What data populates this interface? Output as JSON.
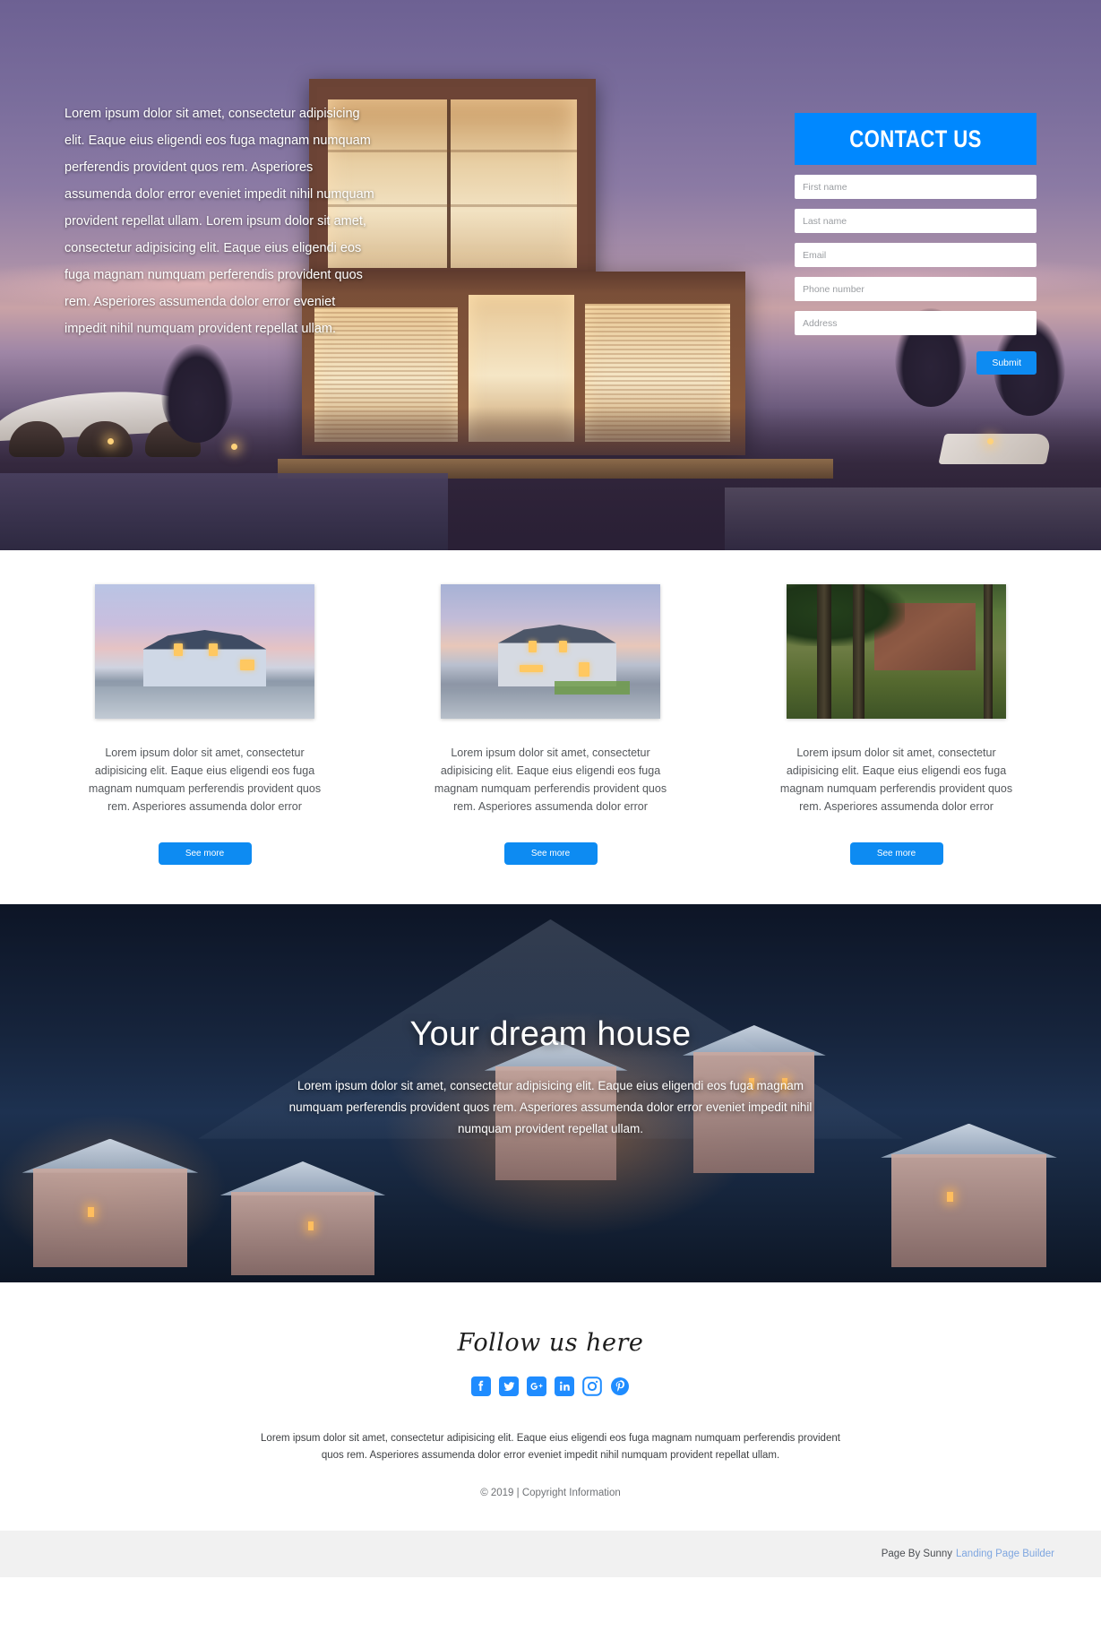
{
  "theme": {
    "accent_blue": "#0088ff",
    "button_blue": "#0d8bf2",
    "bottom_bar_bg": "#f1f1f1",
    "link_blue": "#7ea6e0"
  },
  "hero": {
    "paragraph": "Lorem ipsum dolor sit amet, consectetur adipisicing elit. Eaque eius eligendi eos fuga magnam numquam perferendis provident quos rem. Asperiores assumenda dolor error eveniet impedit nihil numquam provident repellat ullam. Lorem ipsum dolor sit amet, consectetur adipisicing elit. Eaque eius eligendi eos fuga magnam numquam perferendis provident quos rem. Asperiores assumenda dolor error eveniet impedit nihil numquam provident repellat ullam.",
    "form": {
      "title": "CONTACT US",
      "fields": [
        {
          "name": "first-name",
          "placeholder": "First name",
          "value": ""
        },
        {
          "name": "last-name",
          "placeholder": "Last name",
          "value": ""
        },
        {
          "name": "email",
          "placeholder": "Email",
          "value": ""
        },
        {
          "name": "phone",
          "placeholder": "Phone number",
          "value": ""
        },
        {
          "name": "address",
          "placeholder": "Address",
          "value": ""
        }
      ],
      "submit_label": "Submit"
    }
  },
  "cards": {
    "button_label": "See more",
    "items": [
      {
        "image_alt": "suburban-house-at-dusk",
        "text": "Lorem ipsum dolor sit amet, consectetur adipisicing elit. Eaque eius eligendi eos fuga magnam numquam perferendis provident quos rem. Asperiores assumenda dolor error",
        "button_label": "See more"
      },
      {
        "image_alt": "two-story-house-wet-street",
        "text": "Lorem ipsum dolor sit amet, consectetur adipisicing elit. Eaque eius eligendi eos fuga magnam numquam perferendis provident quos rem. Asperiores assumenda dolor error",
        "button_label": "See more"
      },
      {
        "image_alt": "brick-house-in-forest-with-child",
        "text": "Lorem ipsum dolor sit amet, consectetur adipisicing elit. Eaque eius eligendi eos fuga magnam numquam perferendis provident quos rem. Asperiores assumenda dolor error",
        "button_label": "See more"
      }
    ]
  },
  "dream": {
    "title": "Your dream house",
    "subtitle": "Lorem ipsum dolor sit amet, consectetur adipisicing elit. Eaque eius eligendi eos fuga magnam numquam perferendis provident quos rem. Asperiores assumenda dolor error eveniet impedit nihil numquam provident repellat ullam."
  },
  "footer": {
    "follow_heading": "Follow us here",
    "socials": [
      {
        "name": "facebook-icon",
        "label": "Facebook"
      },
      {
        "name": "twitter-icon",
        "label": "Twitter"
      },
      {
        "name": "google-plus-icon",
        "label": "Google Plus"
      },
      {
        "name": "linkedin-icon",
        "label": "LinkedIn"
      },
      {
        "name": "instagram-icon",
        "label": "Instagram"
      },
      {
        "name": "pinterest-icon",
        "label": "Pinterest"
      }
    ],
    "text": "Lorem ipsum dolor sit amet, consectetur adipisicing elit. Eaque eius eligendi eos fuga magnam numquam perferendis provident quos rem. Asperiores assumenda dolor error eveniet impedit nihil numquam provident repellat ullam.",
    "copyright": "© 2019 | Copyright Information"
  },
  "bottom_bar": {
    "by_text": "Page By Sunny",
    "link_text": "Landing Page Builder"
  }
}
